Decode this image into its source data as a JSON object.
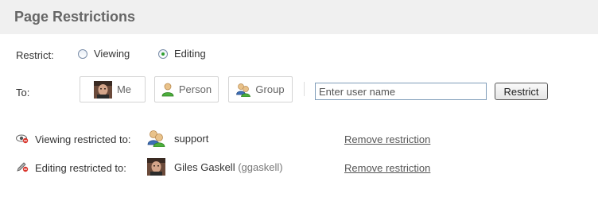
{
  "header": {
    "title": "Page Restrictions"
  },
  "restrict": {
    "label": "Restrict:",
    "options": [
      {
        "label": "Viewing",
        "checked": false
      },
      {
        "label": "Editing",
        "checked": true
      }
    ]
  },
  "to": {
    "label": "To:",
    "buttons": {
      "me": "Me",
      "person": "Person",
      "group": "Group"
    },
    "input_placeholder": "Enter user name",
    "restrict_button": "Restrict"
  },
  "restrictions": [
    {
      "label": "Viewing restricted to:",
      "entity": "support",
      "user": "",
      "action": "Remove restriction",
      "icon": "eye-restricted-icon",
      "entity_icon": "group-icon"
    },
    {
      "label": "Editing restricted to:",
      "entity": "Giles Gaskell",
      "user": "(ggaskell)",
      "action": "Remove restriction",
      "icon": "pencil-restricted-icon",
      "entity_icon": "avatar"
    }
  ],
  "colors": {
    "header_bg": "#f0f0f0",
    "title": "#666666",
    "radio_checked": "#2f9e2f"
  }
}
